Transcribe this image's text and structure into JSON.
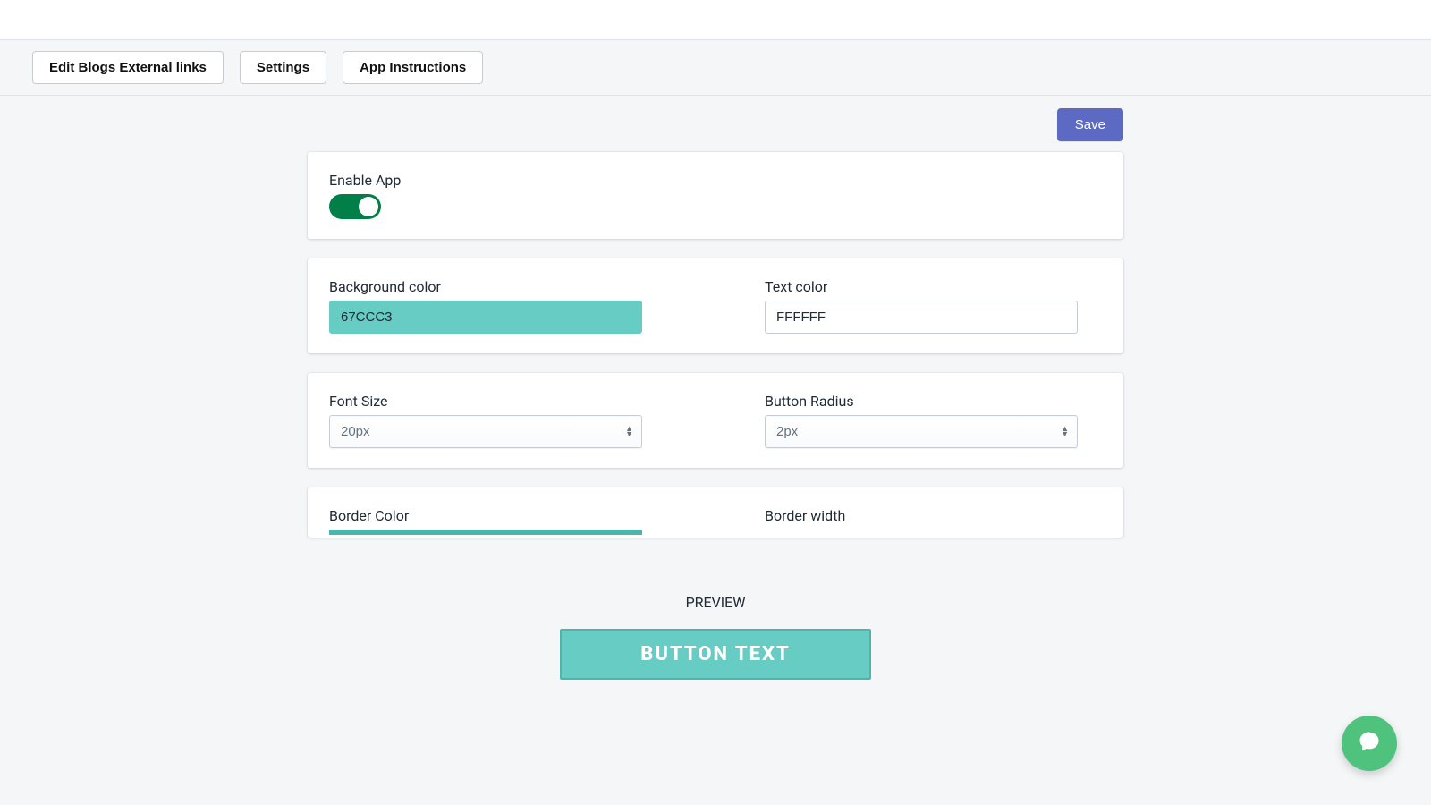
{
  "nav": {
    "tabs": [
      {
        "label": "Edit Blogs External links"
      },
      {
        "label": "Settings"
      },
      {
        "label": "App Instructions"
      }
    ]
  },
  "actions": {
    "save_label": "Save"
  },
  "enable": {
    "label": "Enable App",
    "on": true
  },
  "colors": {
    "background_label": "Background color",
    "background_value": "67CCC3",
    "text_label": "Text color",
    "text_value": "FFFFFF"
  },
  "typography": {
    "font_size_label": "Font Size",
    "font_size_value": "20px",
    "button_radius_label": "Button Radius",
    "button_radius_value": "2px"
  },
  "border": {
    "color_label": "Border Color",
    "width_label": "Border width"
  },
  "preview": {
    "label": "PREVIEW",
    "button_text": "BUTTON TEXT"
  }
}
